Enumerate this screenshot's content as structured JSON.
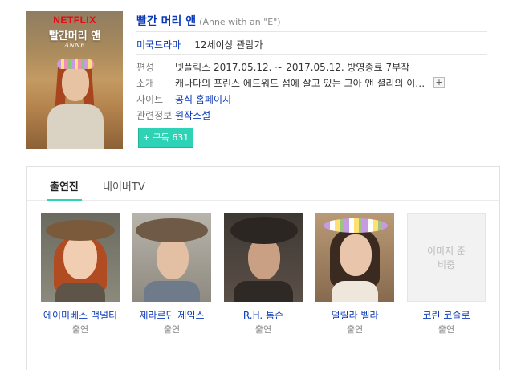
{
  "poster": {
    "brand": "NETFLIX",
    "title_ko": "빨간머리 앤",
    "title_en": "ANNE"
  },
  "header": {
    "title": "빨간 머리 앤",
    "original_title": "(Anne with an \"E\")"
  },
  "meta": {
    "genre": "미국드라마",
    "age_rating": "12세이상 관람가"
  },
  "info": [
    {
      "key": "편성",
      "value": "넷플릭스 2017.05.12. ~ 2017.05.12. 방영종료 7부작"
    },
    {
      "key": "소개",
      "value": "캐나다의 프린스 에드워드 섬에 살고 있는 고아 앤 셜리의 이야..."
    },
    {
      "key": "사이트",
      "value": "공식 홈페이지"
    },
    {
      "key": "관련정보",
      "value": "원작소설"
    }
  ],
  "subscribe": {
    "label": "+ 구독 631"
  },
  "tabs": [
    {
      "label": "출연진",
      "active": true
    },
    {
      "label": "네이버TV",
      "active": false
    }
  ],
  "cast": [
    {
      "name": "에이미베스 맥널티",
      "role": "출연"
    },
    {
      "name": "제라르딘 제임스",
      "role": "출연"
    },
    {
      "name": "R.H. 톰슨",
      "role": "출연"
    },
    {
      "name": "덜릴라 벨라",
      "role": "출연"
    },
    {
      "name": "코린 코슬로",
      "role": "출연",
      "placeholder": "이미지 준비중"
    }
  ],
  "colors": {
    "link": "#0c3ab7",
    "accent": "#2ed3b6",
    "netflix": "#e50914"
  }
}
